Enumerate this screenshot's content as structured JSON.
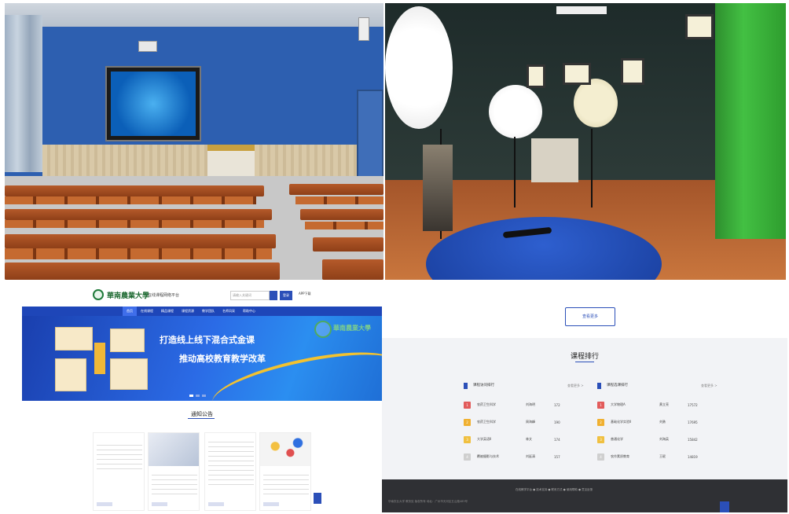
{
  "website": {
    "logo_name": "華南農業大學",
    "logo_subtitle": "在线课程网络平台",
    "search_placeholder": "请输入关键词",
    "login_label": "登录",
    "user_label": "APP下载",
    "nav": [
      "首页",
      "在线课程",
      "精品课程",
      "课程资源",
      "教学团队",
      "名师风采",
      "帮助中心"
    ],
    "banner_line1": "打造线上线下混合式金课",
    "banner_line2": "推动高校教育教学改革",
    "seal_text": "華南農業大學",
    "notice_title": "通知公告"
  },
  "ranking": {
    "more_button": "查看更多",
    "title": "课程排行",
    "left_col": {
      "heading": "课程访问排行",
      "more": "查看更多 >",
      "rows": [
        {
          "rank": "1",
          "name": "农药卫生科学",
          "teacher": "刘海明",
          "count": "172"
        },
        {
          "rank": "2",
          "name": "农药卫生科学",
          "teacher": "周海峰",
          "count": "190"
        },
        {
          "rank": "3",
          "name": "大学英语Ⅱ",
          "teacher": "林文",
          "count": "174"
        },
        {
          "rank": "4",
          "name": "覆被摄影与技术",
          "teacher": "刘延清",
          "count": "157"
        }
      ]
    },
    "right_col": {
      "heading": "课程选课排行",
      "more": "查看更多 >",
      "rows": [
        {
          "rank": "1",
          "name": "大学物理A",
          "teacher": "黄立亮",
          "count": "17572"
        },
        {
          "rank": "2",
          "name": "基础化学实验Ⅱ",
          "teacher": "刘勇",
          "count": "17695"
        },
        {
          "rank": "3",
          "name": "普通化学",
          "teacher": "刘海英",
          "count": "15842"
        },
        {
          "rank": "4",
          "name": "农作素质教育",
          "teacher": "王珉",
          "count": "14819"
        }
      ]
    },
    "footer_line1": "在线教学平台 ● 技术支持 ● 联系方式 ● 使用帮助 ● 意见反馈",
    "footer_line2": "华南农业大学 教务处 版权所有 地址：广州市天河区五山路483号"
  },
  "colors": {
    "primary": "#2b4fb8",
    "badge": [
      "#e25b5b",
      "#f0b030",
      "#f0c040",
      "#cfcfcf"
    ]
  }
}
